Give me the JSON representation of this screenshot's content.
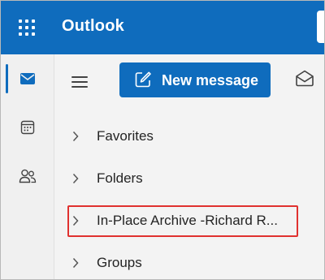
{
  "app": {
    "title": "Outlook",
    "accent": "#0f6cbd",
    "highlight_color": "#e0312f"
  },
  "topbar": {
    "launcher_icon": "waffle-grid-icon"
  },
  "rail": {
    "items": [
      {
        "name": "mail",
        "icon": "mail-icon",
        "active": true
      },
      {
        "name": "calendar",
        "icon": "calendar-icon",
        "active": false
      },
      {
        "name": "people",
        "icon": "people-icon",
        "active": false
      }
    ]
  },
  "toolbar": {
    "menu_icon": "hamburger-icon",
    "new_message_label": "New message",
    "new_message_icon": "compose-icon",
    "read_icon": "envelope-open-icon"
  },
  "folders": {
    "items": [
      {
        "label": "Favorites",
        "icon": "chevron-right-icon"
      },
      {
        "label": "Folders",
        "icon": "chevron-right-icon"
      },
      {
        "label": "In-Place Archive -Richard R...",
        "icon": "chevron-right-icon",
        "highlighted": true
      },
      {
        "label": "Groups",
        "icon": "chevron-right-icon"
      }
    ]
  }
}
